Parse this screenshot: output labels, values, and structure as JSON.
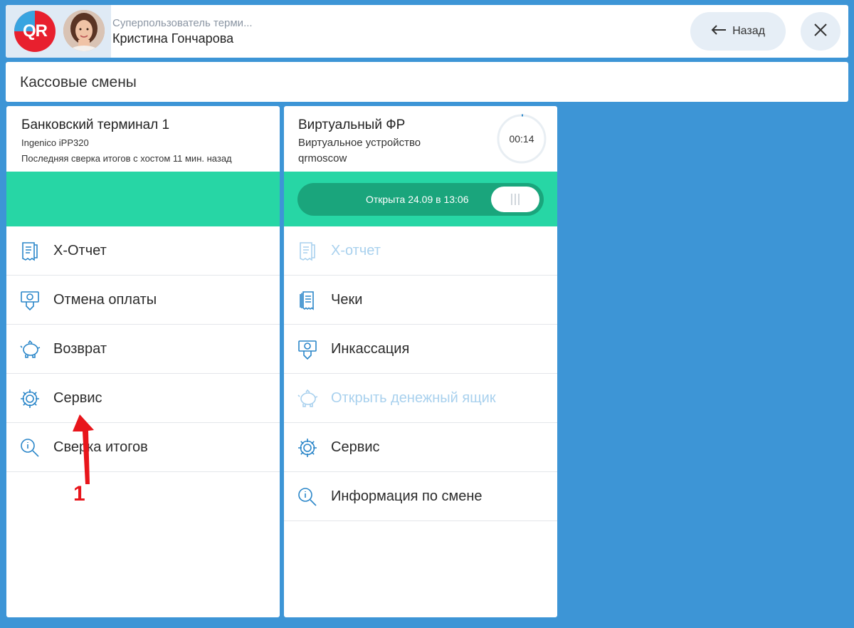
{
  "header": {
    "user_role": "Суперпользователь терми...",
    "user_name": "Кристина Гончарова",
    "back_label": "Назад",
    "logo_text": "QR"
  },
  "page": {
    "title": "Кассовые смены"
  },
  "left_panel": {
    "title": "Банковский терминал 1",
    "device": "Ingenico iPP320",
    "status": "Последняя сверка итогов с хостом 11 мин. назад",
    "items": [
      {
        "label": "Х-Отчет",
        "icon": "receipt-icon",
        "disabled": false
      },
      {
        "label": "Отмена оплаты",
        "icon": "cash-hand-icon",
        "disabled": false
      },
      {
        "label": "Возврат",
        "icon": "piggy-bank-icon",
        "disabled": false
      },
      {
        "label": "Сервис",
        "icon": "gear-icon",
        "disabled": false
      },
      {
        "label": "Сверка итогов",
        "icon": "info-search-icon",
        "disabled": false
      }
    ]
  },
  "right_panel": {
    "title": "Виртуальный ФР",
    "device": "Виртуальное устройство",
    "location": "qrmoscow",
    "timer": "00:14",
    "toggle_label": "Открыта 24.09 в 13:06",
    "items": [
      {
        "label": "Х-отчет",
        "icon": "receipt-icon",
        "disabled": true
      },
      {
        "label": "Чеки",
        "icon": "receipts-stack-icon",
        "disabled": false
      },
      {
        "label": "Инкассация",
        "icon": "cash-hand-icon",
        "disabled": false
      },
      {
        "label": "Открыть денежный ящик",
        "icon": "piggy-bank-icon",
        "disabled": true
      },
      {
        "label": "Сервис",
        "icon": "gear-icon",
        "disabled": false
      },
      {
        "label": "Информация по смене",
        "icon": "info-search-icon",
        "disabled": false
      }
    ]
  },
  "annotation": {
    "number": "1"
  },
  "colors": {
    "background": "#3d95d6",
    "accent_green": "#27d6a5",
    "toggle_green": "#1aa57c",
    "icon_blue": "#2a86c9",
    "disabled_text": "#a9d1ee",
    "annotation_red": "#e8151b"
  }
}
